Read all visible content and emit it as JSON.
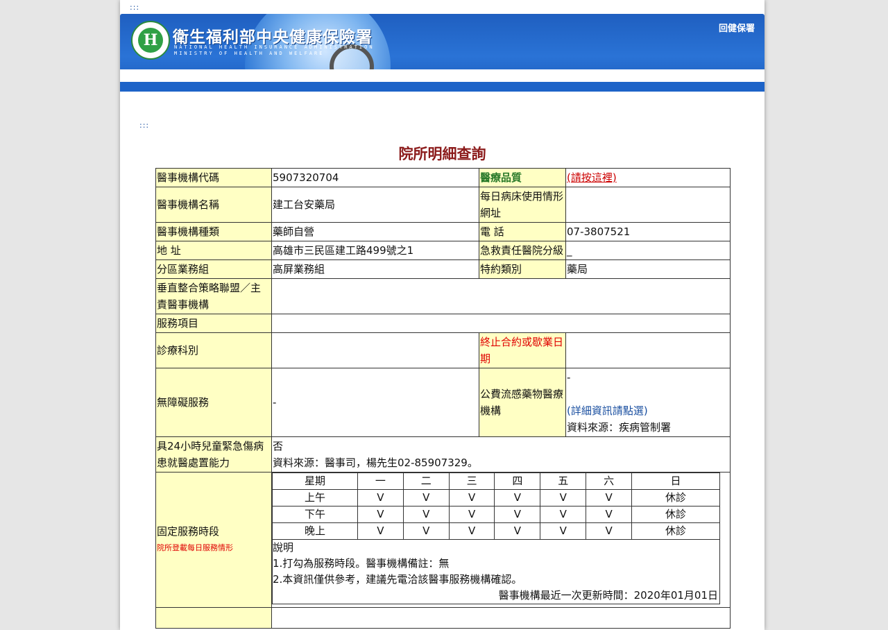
{
  "accesskey": ":::",
  "header": {
    "org_name": "衛生福利部中央健康保險署",
    "org_en_line1": "NATIONAL HEALTH INSURANCE ADMINISTRATION",
    "org_en_line2": "MINISTRY OF HEALTH AND WELFARE",
    "logo_glyph": "H",
    "back_link": "回健保署"
  },
  "title": "院所明細查詢",
  "detail": {
    "code_label": "醫事機構代碼",
    "code_value": "5907320704",
    "quality_label": "醫療品質",
    "quality_link": "(請按這裡)",
    "name_label": "醫事機構名稱",
    "name_value": "建工台安藥局",
    "bed_label": "每日病床使用情形網址",
    "bed_value": "",
    "type_label": "醫事機構種類",
    "type_value": "藥師自營",
    "phone_label": "電 話",
    "phone_value": "07-3807521",
    "address_label": "地 址",
    "address_value": "高雄市三民區建工路499號之1",
    "emergency_label": "急救責任醫院分級",
    "emergency_value": "_",
    "branch_label": "分區業務組",
    "branch_value": "高屏業務組",
    "contract_label": "特約類別",
    "contract_value": "藥局",
    "alliance_label": "垂直整合策略聯盟／主責醫事機構",
    "alliance_value": "",
    "service_label": "服務項目",
    "service_value": "",
    "dept_label": "診療科別",
    "dept_value": "",
    "terminate_label": "終止合約或歇業日期",
    "terminate_value": "",
    "barrier_label": "無障礙服務",
    "barrier_value": "-",
    "flu_label": "公費流感藥物醫療機構",
    "flu_value": "-",
    "flu_link": "(詳細資訊請點選)",
    "flu_source": "資料來源：疾病管制署",
    "child_label": "具24小時兒童緊急傷病患就醫處置能力",
    "child_value": "否",
    "child_source": "資料來源：醫事司，楊先生02-85907329。",
    "hours_label": "固定服務時段",
    "hours_sublabel": "院所登載每日服務情形"
  },
  "hours": {
    "header": [
      "星期",
      "一",
      "二",
      "三",
      "四",
      "五",
      "六",
      "日"
    ],
    "rows": [
      [
        "上午",
        "V",
        "V",
        "V",
        "V",
        "V",
        "V",
        "休診"
      ],
      [
        "下午",
        "V",
        "V",
        "V",
        "V",
        "V",
        "V",
        "休診"
      ],
      [
        "晚上",
        "V",
        "V",
        "V",
        "V",
        "V",
        "V",
        "休診"
      ]
    ],
    "notes_title": "說明",
    "note1": "1.打勾為服務時段。醫事機構備註：無",
    "note2": "2.本資訊僅供參考，建議先電洽該醫事服務機構確認。",
    "updated": "醫事機構最近一次更新時間：2020年01月01日"
  },
  "colors": {
    "banner_blue": "#1f5fc0",
    "label_bg": "#ffffc4",
    "title_red": "#8b1a1a",
    "quality_green": "#2a7a2a"
  }
}
